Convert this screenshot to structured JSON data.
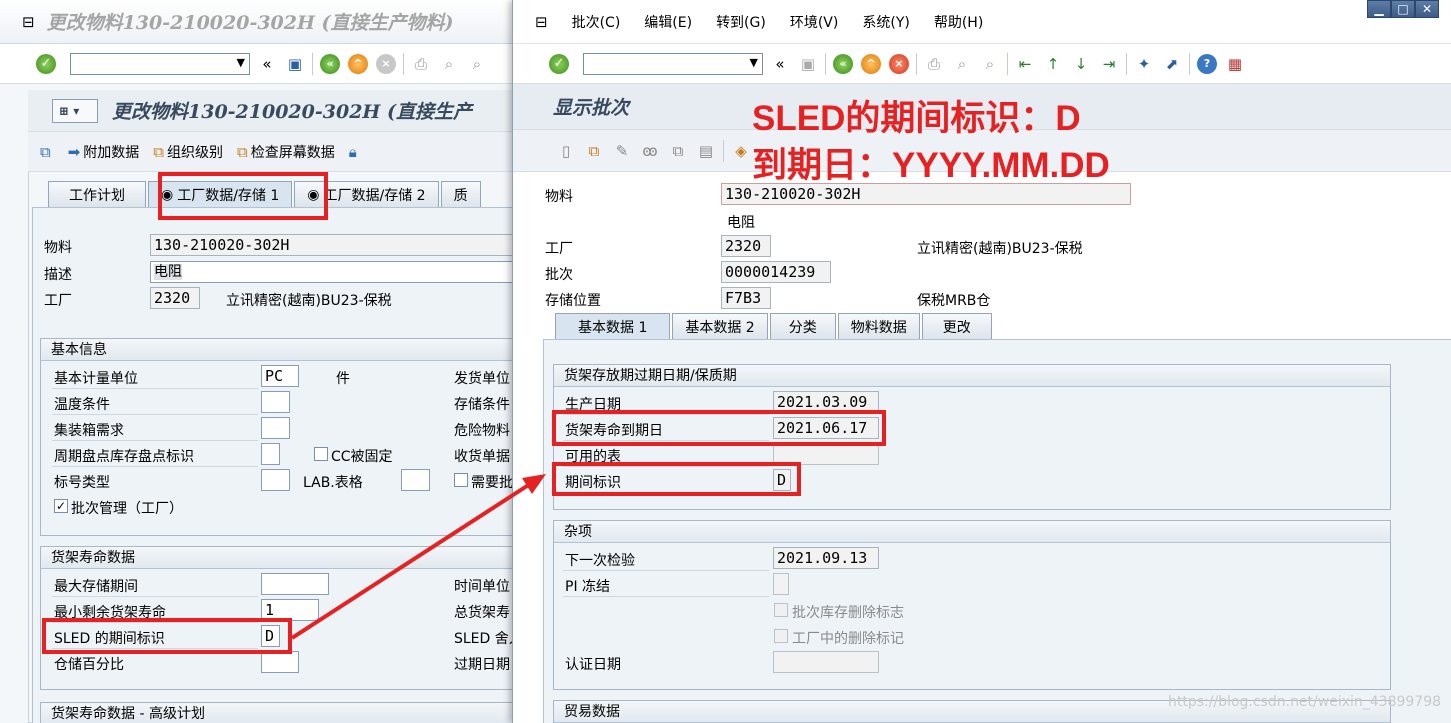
{
  "left": {
    "window_title": "更改物料130-210020-302H (直接生产物料)",
    "screen_title": "更改物料130-210020-302H (直接生产",
    "app_toolbar": [
      "附加数据",
      "组织级别",
      "检查屏幕数据"
    ],
    "tabs": [
      "工作计划",
      "工厂数据/存储 1",
      "工厂数据/存储 2",
      "质"
    ],
    "header": {
      "material_label": "物料",
      "material_value": "130-210020-302H",
      "desc_label": "描述",
      "desc_value": "电阻",
      "plant_label": "工厂",
      "plant_value": "2320",
      "plant_name": "立讯精密(越南)BU23-保税"
    },
    "basic": {
      "title": "基本信息",
      "base_uom_label": "基本计量单位",
      "base_uom_value": "PC",
      "base_uom_text": "件",
      "temp_label": "温度条件",
      "container_label": "集装箱需求",
      "cycle_label": "周期盘点库存盘点标识",
      "cc_fixed_label": "CC被固定",
      "label_type_label": "标号类型",
      "lab_label": "LAB.表格",
      "batch_mgmt_label": "批次管理（工厂）",
      "right_col": [
        "发货单位",
        "存储条件",
        "危险物料",
        "收货单据",
        "需要批"
      ]
    },
    "shelf": {
      "title": "货架寿命数据",
      "max_storage_label": "最大存储期间",
      "min_remaining_label": "最小剩余货架寿命",
      "min_remaining_value": "1",
      "sled_label": "SLED 的期间标识",
      "sled_value": "D",
      "storage_pct_label": "仓储百分比",
      "right_col": [
        "时间单位",
        "总货架寿",
        "SLED 舍入",
        "过期日期"
      ]
    },
    "advanced_title": "货架寿命数据 - 高级计划"
  },
  "right": {
    "menu": [
      "批次(C)",
      "编辑(E)",
      "转到(G)",
      "环境(V)",
      "系统(Y)",
      "帮助(H)"
    ],
    "screen_title": "显示批次",
    "header": {
      "material_label": "物料",
      "material_value": "130-210020-302H",
      "material_desc": "电阻",
      "plant_label": "工厂",
      "plant_value": "2320",
      "plant_name": "立讯精密(越南)BU23-保税",
      "batch_label": "批次",
      "batch_value": "0000014239",
      "sloc_label": "存储位置",
      "sloc_value": "F7B3",
      "sloc_name": "保税MRB仓"
    },
    "tabs": [
      "基本数据 1",
      "基本数据 2",
      "分类",
      "物料数据",
      "更改"
    ],
    "sled_group": {
      "title": "货架存放期过期日期/保质期",
      "prod_date_label": "生产日期",
      "prod_date_value": "2021.03.09",
      "sled_label": "货架寿命到期日",
      "sled_value": "2021.06.17",
      "avail_label": "可用的表",
      "period_label": "期间标识",
      "period_value": "D"
    },
    "misc_group": {
      "title": "杂项",
      "next_insp_label": "下一次检验",
      "next_insp_value": "2021.09.13",
      "pi_label": "PI 冻结",
      "del_flag_label": "批次库存删除标志",
      "plant_del_label": "工厂中的删除标记",
      "cert_label": "认证日期"
    },
    "trade_title": "贸易数据"
  },
  "annotation": {
    "line1": "SLED的期间标识：D",
    "line2": "到期日：YYYY.MM.DD"
  },
  "watermark": "https://blog.csdn.net/weixin_43899798",
  "colors": {
    "annotation_red": "#e62121",
    "sap_blue_bg": "#eef3f8"
  }
}
